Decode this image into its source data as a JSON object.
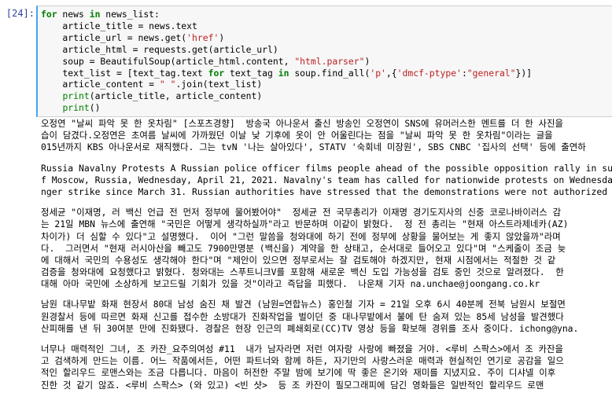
{
  "cell": {
    "prompt": "[24]:",
    "code_lines": [
      [
        {
          "t": "for",
          "c": "kw"
        },
        {
          "t": " news "
        },
        {
          "t": "in",
          "c": "kw"
        },
        {
          "t": " news_list:"
        }
      ],
      [
        {
          "t": "    article_title = news.text"
        }
      ],
      [
        {
          "t": "    article_url = news.get("
        },
        {
          "t": "'href'",
          "c": "str"
        },
        {
          "t": ")"
        }
      ],
      [
        {
          "t": "    article_html = requests.get(article_url)"
        }
      ],
      [
        {
          "t": "    soup = BeautifulSoup(article_html.content, "
        },
        {
          "t": "\"html.parser\"",
          "c": "str"
        },
        {
          "t": ")"
        }
      ],
      [
        {
          "t": "    text_list = [text_tag.text "
        },
        {
          "t": "for",
          "c": "kw"
        },
        {
          "t": " text_tag "
        },
        {
          "t": "in",
          "c": "kw"
        },
        {
          "t": " soup.find_all("
        },
        {
          "t": "'p'",
          "c": "str"
        },
        {
          "t": ",{"
        },
        {
          "t": "'dmcf-ptype'",
          "c": "str"
        },
        {
          "t": ":"
        },
        {
          "t": "\"general\"",
          "c": "str"
        },
        {
          "t": "})]"
        }
      ],
      [
        {
          "t": "    article_content = "
        },
        {
          "t": "\" \"",
          "c": "str"
        },
        {
          "t": ".join(text_list)"
        }
      ],
      [
        {
          "t": "    "
        },
        {
          "t": "print",
          "c": "blt"
        },
        {
          "t": "(article_title, article_content)"
        }
      ],
      [
        {
          "t": "    "
        },
        {
          "t": "print",
          "c": "blt"
        },
        {
          "t": "()"
        }
      ]
    ]
  },
  "output": {
    "paragraphs": [
      [
        "오정연 \"날씨 파악 못 한 옷차림\" [스포츠경향]  방송국 아나운서 출신 방송인 오정연이 SNS에 유머러스한 멘트를 더 한 사진을",
        "습이 담겼다.오정연은 초여름 날씨에 가까웠던 이날 낮 기후에 옷이 안 어울린다는 점을 \"날씨 파악 못 한 옷차림\"이라는 글을",
        "015년까지 KBS 아나운서로 재직했다. 그는 tvN '나는 살아있다', STATV '숙회네 미장원', SBS CNBC '집사의 선택' 등에 출연하"
      ],
      [
        "Russia Navalny Protests A Russian police officer films people ahead of the possible opposition rally in support of",
        "f Moscow, Russia, Wednesday, April 21, 2021. Navalny's team has called for nationwide protests on Wednesday follo",
        "nger strike since March 31. Russian authorities have stressed that the demonstrations were not authorized and war"
      ],
      [
        "정세균 \"이재명, 러 백신 언급 전 먼저 정부에 물어봤어야\"  정세균 전 국무총리가 이재명 경기도지사의 신중 코로나바이러스 감",
        "는 21일 MBN 뉴스에 출연해 \"국민은 어떻게 생각하실까\"라고 반문하며 이같이 밝혔다.  정 전 총리는 \"현재 아스트라제네카(AZ)",
        "차이가) 더 심할 수 있다\"고 설명했다.  이어 \"그런 말씀을 청와대에 하기 전에 정부에 상황을 물어보는 게 좋지 않았을까\"라며",
        "다.  그러면서 \"현재 러시아산을 빼고도 7900만명분 (백신을) 계약을 한 상태고, 순서대로 들어오고 있다\"며 \"스케줄이 조금 늦",
        "에 대해서 국민의 수용성도 생각해야 한다\"며 \"제안이 있으면 정부로서는 잘 검토해야 하겠지만, 현재 시점에서는 적절한 것 같",
        "검증을 청와대에 요청했다고 밝혔다. 청와대는 스푸트니크V를 포함해 새로운 백신 도입 가능성을 검토 중인 것으로 알려졌다.  한",
        "대해 아마 국민에 소상하게 보고드릴 기회가 있을 것\"이라고 즉답을 피했다.  나운채 기자 na.unchae@joongang.co.kr"
      ],
      [
        "남원 대나무밭 화재 현장서 80대 남성 숨진 채 발견 (남원=연합뉴스) 홍인철 기자 = 21일 오후 6시 40분께 전북 남원시 보절면",
        "원경찰서 등에 따르면 화재 신고를 접수한 소방대가 진화작업을 벌이던 중 대나무밭에서 불에 탄 숨져 있는 85세 남성을 발견했다",
        "산피해를 낸 뒤 30여분 만에 진화됐다. 경찰은 현장 인근의 폐쇄회로(CC)TV 영상 등을 확보해 경위를 조사 중이다. ichong@yna."
      ],
      [
        "너무나 매력적인 그녀, 조 카잔_요주의여성 #11  내가 남자라면 저런 여자랑 사랑에 빠졌을 거야. <루비 스팍스>에서 조 카잔을",
        "고 검색하게 만드는 이름. 어느 작품에서든, 어떤 파트너와 함께 하든, 자기만의 사랑스러운 매력과 현실적인 연기로 공감을 일으",
        "적인 할리우드 로맨스와는 조금 다릅니다. 마음이 허전한 주말 밤에 보기에 딱 좋은 온기와 재미를 지녔지요. 주이 디샤넬 이후",
        "진한 것 같기 않죠. <루비 스팍스> (와 있고) <빈 샷>  등 조 카잔이 필모그래피에 담긴 영화들은 일반적인 할리우드 로맨"
      ]
    ]
  }
}
